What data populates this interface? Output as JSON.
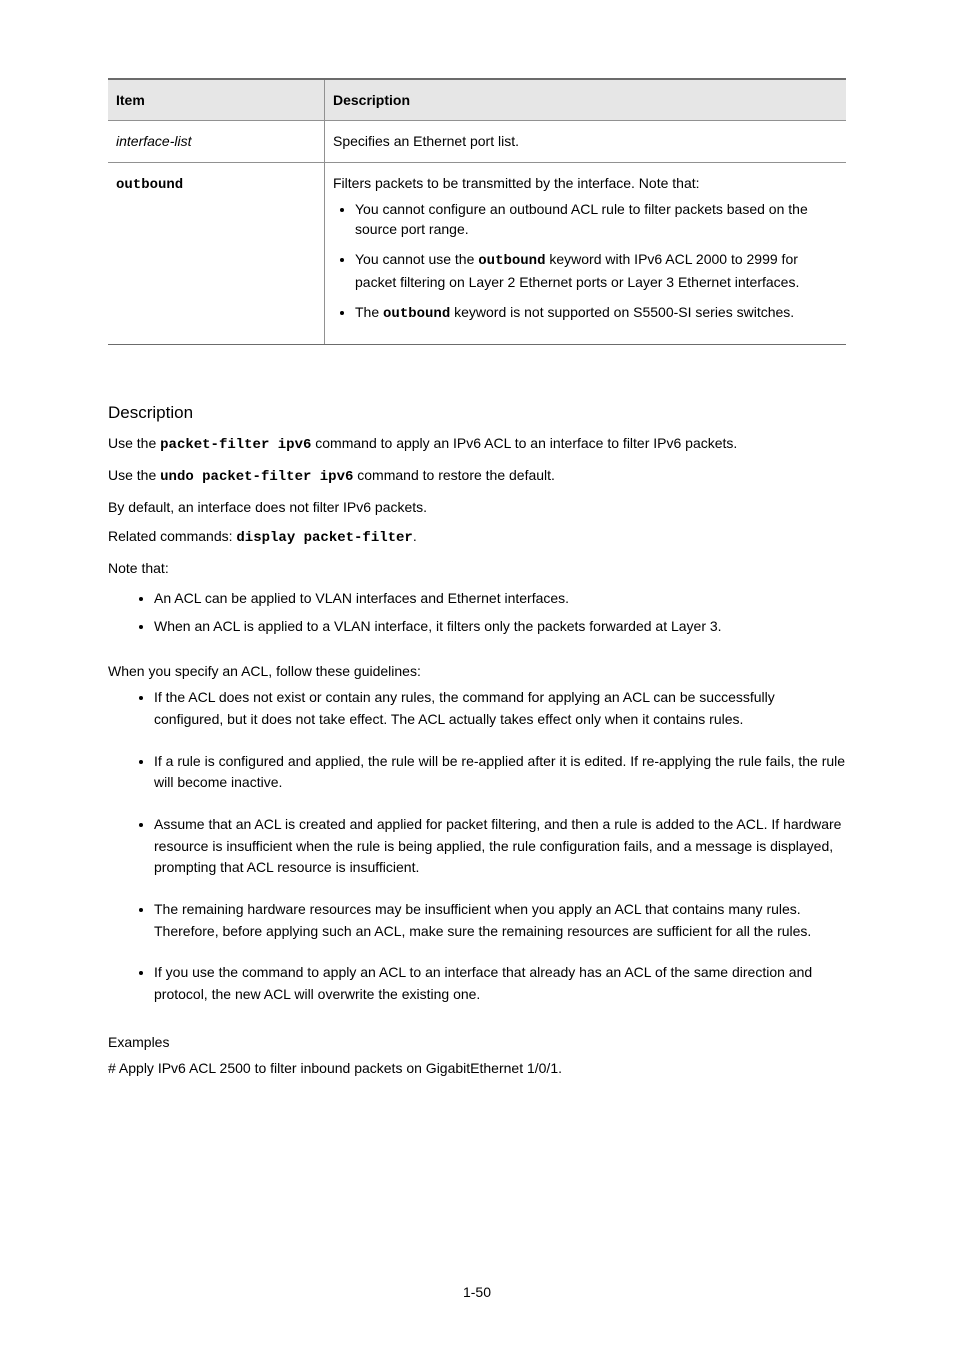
{
  "table": {
    "headers": [
      "Item",
      "Description"
    ],
    "rows": [
      {
        "item_html": "<span class=\"ital\">interface-list</span>",
        "desc_html": "Specifies an Ethernet port list."
      },
      {
        "item_html": "<span class=\"mono\">outbound</span>",
        "desc_lead": "Filters packets to be transmitted by the interface. Note that:",
        "bullets": [
          "You cannot configure an outbound ACL rule to filter packets based on the source port range.",
          "You cannot use the <span class=\"mono\">outbound</span> keyword with IPv6 ACL 2000 to 2999 for packet filtering on Layer 2 Ethernet ports or Layer 3 Ethernet interfaces.",
          "The <span class=\"mono\">outbound</span> keyword is not supported on S5500-SI series switches."
        ]
      }
    ]
  },
  "heading1": "Description",
  "desc_paragraphs": [
    "Use the <span class=\"mono-inline\">packet-filter ipv6</span> command to apply an IPv6 ACL to an interface to filter IPv6 packets.",
    "Use the <span class=\"mono-inline\">undo packet-filter ipv6</span> command to restore the default.",
    "By default, an interface does not filter IPv6 packets.",
    "Related commands: <span class=\"mono-inline\">display packet-filter</span>.",
    "Note that:"
  ],
  "desc_bullets": [
    "An ACL can be applied to VLAN interfaces and Ethernet interfaces.",
    "When an ACL is applied to a VLAN interface, it filters only the packets forwarded at Layer 3."
  ],
  "tips_intro": "When you specify an ACL, follow these guidelines:",
  "tips": [
    "If the ACL does not exist or contain any rules, the command for applying an ACL can be successfully configured, but it does not take effect. The ACL actually takes effect only when it contains rules.",
    "If a rule is configured and applied, the rule will be re-applied after it is edited. If re-applying the rule fails, the rule will become inactive.",
    "Assume that an ACL is created and applied for packet filtering, and then a rule is added to the ACL. If hardware resource is insufficient when the rule is being applied, the rule configuration fails, and a message is displayed, prompting that ACL resource is insufficient.",
    "The remaining hardware resources may be insufficient when you apply an ACL that contains many rules. Therefore, before applying such an ACL, make sure the remaining resources are sufficient for all the rules.",
    "If you use the command to apply an ACL to an interface that already has an ACL of the same direction and protocol, the new ACL will overwrite the existing one."
  ],
  "subhead": "Examples",
  "example_text": "# Apply IPv6 ACL 2500 to filter inbound packets on GigabitEthernet 1/0/1.",
  "page_number": "1-50"
}
